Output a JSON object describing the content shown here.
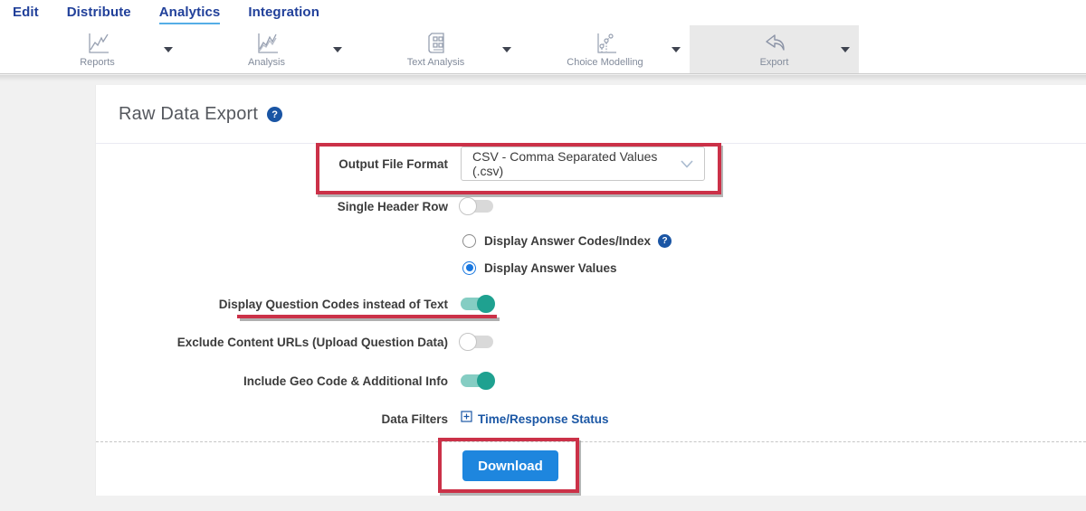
{
  "nav": {
    "items": [
      {
        "label": "Edit",
        "active": false
      },
      {
        "label": "Distribute",
        "active": false
      },
      {
        "label": "Analytics",
        "active": true
      },
      {
        "label": "Integration",
        "active": false
      }
    ]
  },
  "toolbar": {
    "items": [
      {
        "label": "Reports",
        "icon": "report-line-chart-icon",
        "active": false
      },
      {
        "label": "Analysis",
        "icon": "analysis-line-chart-icon",
        "active": false
      },
      {
        "label": "Text Analysis",
        "icon": "text-analysis-news-icon",
        "active": false
      },
      {
        "label": "Choice Modelling",
        "icon": "choice-modelling-scatter-icon",
        "active": false
      },
      {
        "label": "Export",
        "icon": "export-reply-arrow-icon",
        "active": true
      }
    ]
  },
  "page": {
    "title": "Raw Data Export",
    "help_icon": "?"
  },
  "form": {
    "output_format": {
      "label": "Output File Format",
      "value": "CSV - Comma Separated Values (.csv)"
    },
    "single_header": {
      "label": "Single Header Row",
      "state": "off"
    },
    "radio_group": {
      "options": [
        {
          "label": "Display Answer Codes/Index",
          "state": "unselected",
          "has_help": true,
          "help_icon": "?"
        },
        {
          "label": "Display Answer Values",
          "state": "selected"
        }
      ]
    },
    "question_codes": {
      "label": "Display Question Codes instead of Text",
      "state": "on"
    },
    "exclude_urls": {
      "label": "Exclude Content URLs (Upload Question Data)",
      "state": "off"
    },
    "geo_code": {
      "label": "Include Geo Code & Additional Info",
      "state": "on"
    },
    "data_filters": {
      "label": "Data Filters",
      "link": "Time/Response Status"
    }
  },
  "download": {
    "label": "Download"
  },
  "colors": {
    "nav_blue": "#21409a",
    "nav_underline": "#55aee6",
    "annotation_red": "#cb3148",
    "toggle_on": "#1fa190",
    "radio_selected": "#1877e0",
    "link_blue": "#1b57a5",
    "download_blue": "#1e86de",
    "active_tab_bg": "#e9e9e9"
  }
}
